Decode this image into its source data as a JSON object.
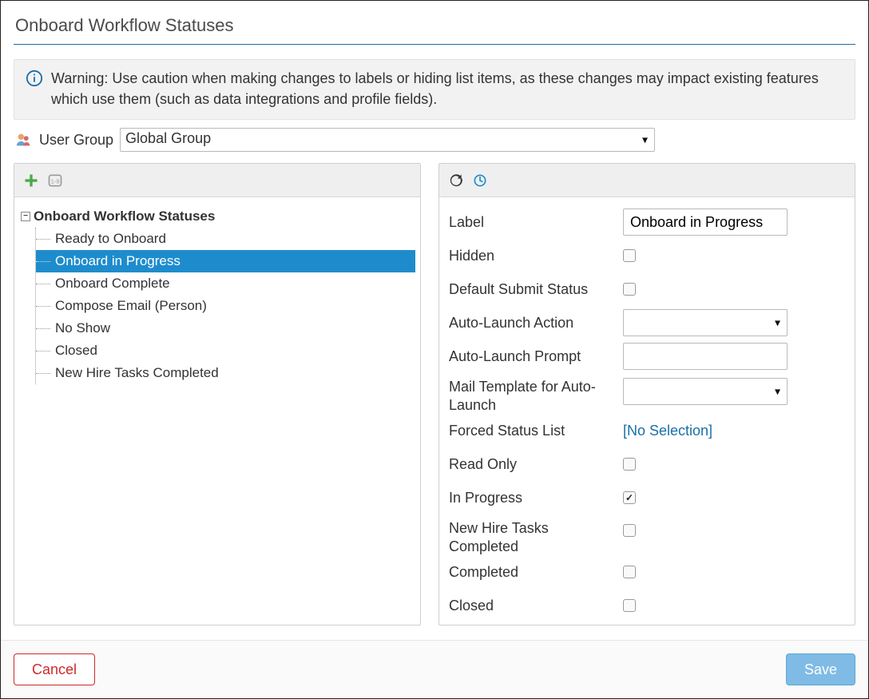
{
  "title": "Onboard Workflow Statuses",
  "warning": "Warning: Use caution when making changes to labels or hiding list items, as these changes may impact existing features which use them (such as data integrations and profile fields).",
  "user_group": {
    "label": "User Group",
    "value": "Global Group"
  },
  "tree": {
    "root_label": "Onboard Workflow Statuses",
    "items": [
      {
        "label": "Ready to Onboard",
        "selected": false
      },
      {
        "label": "Onboard in Progress",
        "selected": true
      },
      {
        "label": "Onboard Complete",
        "selected": false
      },
      {
        "label": "Compose Email (Person)",
        "selected": false
      },
      {
        "label": "No Show",
        "selected": false
      },
      {
        "label": "Closed",
        "selected": false
      },
      {
        "label": "New Hire Tasks Completed",
        "selected": false
      }
    ]
  },
  "form": {
    "label_field": {
      "label": "Label",
      "value": "Onboard in Progress"
    },
    "hidden": {
      "label": "Hidden",
      "checked": false
    },
    "default_submit_status": {
      "label": "Default Submit Status",
      "checked": false
    },
    "auto_launch_action": {
      "label": "Auto-Launch Action",
      "value": ""
    },
    "auto_launch_prompt": {
      "label": "Auto-Launch Prompt",
      "value": ""
    },
    "mail_template": {
      "label": "Mail Template for Auto-Launch",
      "value": ""
    },
    "forced_status_list": {
      "label": "Forced Status List",
      "link_text": "[No Selection]"
    },
    "read_only": {
      "label": "Read Only",
      "checked": false
    },
    "in_progress": {
      "label": "In Progress",
      "checked": true
    },
    "new_hire_tasks_completed": {
      "label": "New Hire Tasks Completed",
      "checked": false
    },
    "completed": {
      "label": "Completed",
      "checked": false
    },
    "closed": {
      "label": "Closed",
      "checked": false
    }
  },
  "footer": {
    "cancel": "Cancel",
    "save": "Save"
  }
}
